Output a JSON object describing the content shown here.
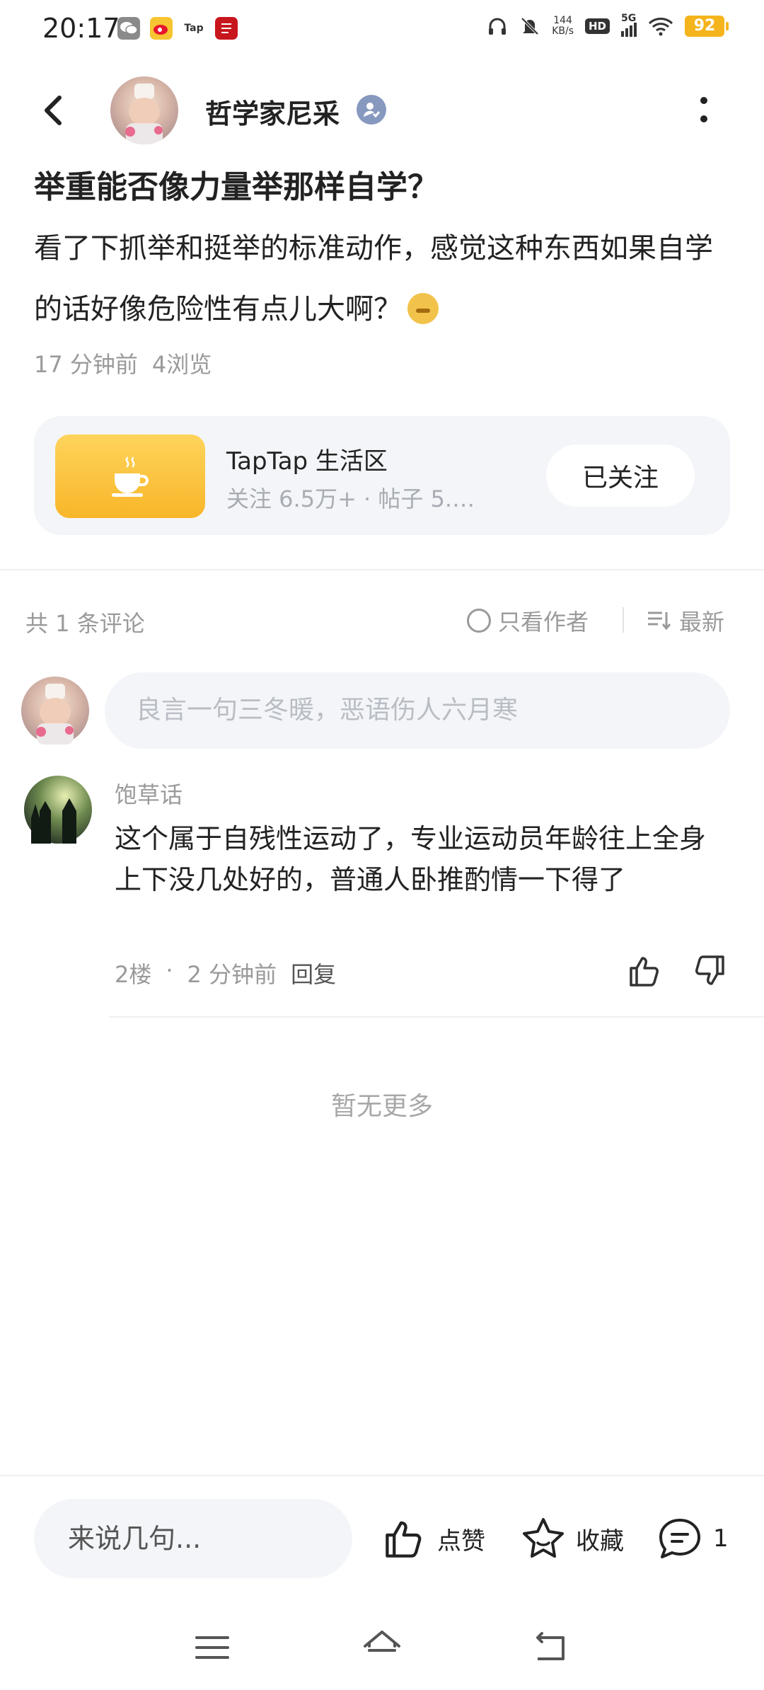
{
  "status_bar": {
    "time": "20:17",
    "apps": [
      {
        "icon": "wechat-icon",
        "color": "#8a8a8a"
      },
      {
        "icon": "weibo-icon",
        "color": "#e6162d"
      },
      {
        "icon": "taptap-icon",
        "label": "Tap",
        "color": "#555555"
      },
      {
        "icon": "news-app-icon",
        "color": "#c8161d"
      }
    ],
    "net_speed_value": "144",
    "net_speed_unit": "KB/s",
    "hd_label": "HD",
    "network_label": "5G",
    "battery": "92"
  },
  "header": {
    "author_name": "哲学家尼采"
  },
  "post": {
    "title": "举重能否像力量举那样自学？",
    "body": "看了下抓举和挺举的标准动作，感觉这种东西如果自学的话好像危险性有点儿大啊？",
    "time_ago": "17 分钟前",
    "views": "4浏览"
  },
  "community": {
    "name": "TapTap 生活区",
    "stats": "关注 6.5万+ · 帖子 5.…",
    "follow_label": "已关注",
    "accent": "#f8b629"
  },
  "comments_section": {
    "count_label": "共 1 条评论",
    "author_only_label": "只看作者",
    "sort_label": "最新",
    "input_placeholder": "良言一句三冬暖，恶语伤人六月寒",
    "items": [
      {
        "user": "饱草话",
        "text": "这个属于自残性运动了，专业运动员年龄往上全身上下没几处好的，普通人卧推酌情一下得了",
        "floor": "2楼",
        "dot": "·",
        "time_ago": "2 分钟前",
        "reply_label": "回复"
      }
    ],
    "no_more": "暂无更多"
  },
  "bottom_bar": {
    "input_placeholder": "来说几句...",
    "like_label": "点赞",
    "favorite_label": "收藏",
    "comment_count": "1"
  }
}
